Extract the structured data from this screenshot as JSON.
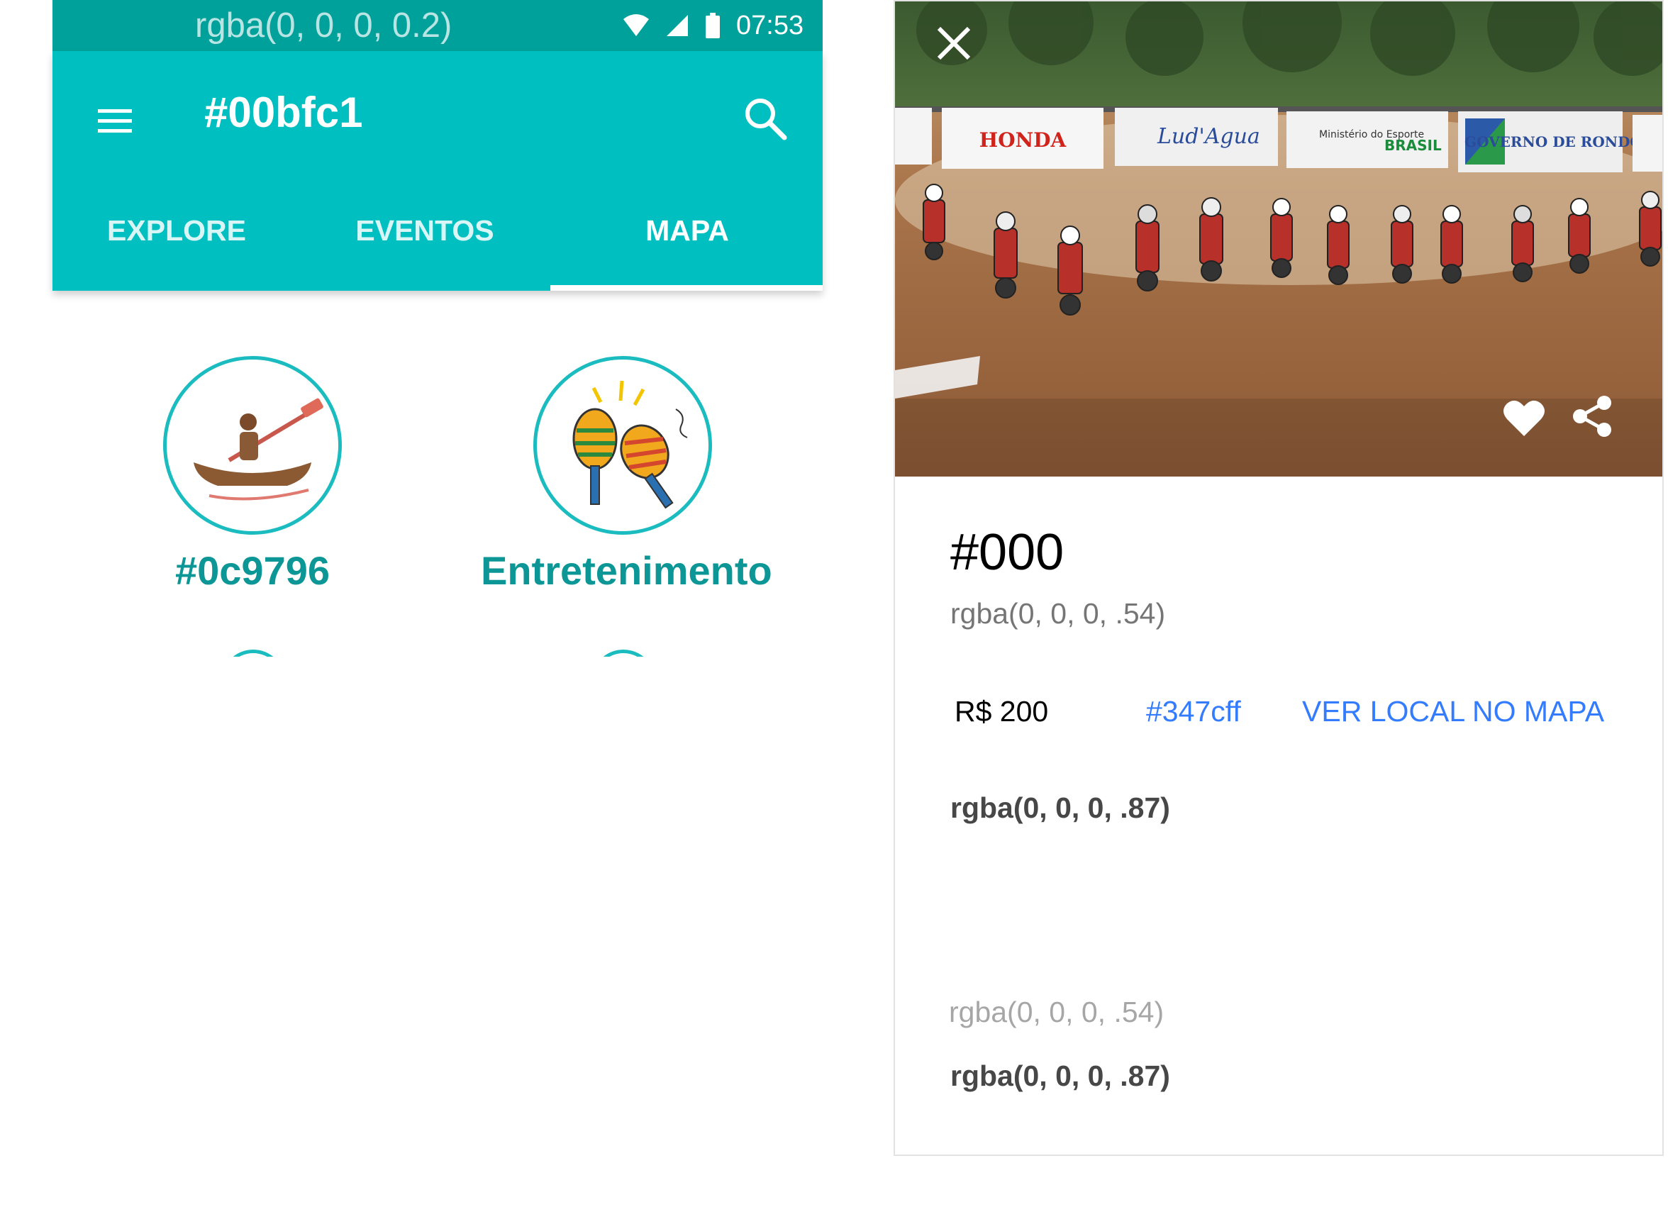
{
  "status_bar": {
    "text": "rgba(0, 0, 0, 0.2)",
    "time": "07:53",
    "icons": [
      "wifi-icon",
      "signal-icon",
      "battery-icon"
    ]
  },
  "app_bar": {
    "title": "#00bfc1",
    "menu_icon": "menu-icon",
    "search_icon": "search-icon",
    "color": "#00bfc1"
  },
  "tabs": [
    {
      "label": "EXPLORE",
      "active": false
    },
    {
      "label": "EVENTOS",
      "active": false
    },
    {
      "label": "MAPA",
      "active": true
    }
  ],
  "categories": [
    {
      "label": "#0c9796",
      "icon": "canoe-icon"
    },
    {
      "label": "Entretenimento",
      "icon": "maracas-icon"
    }
  ],
  "detail": {
    "hero_alt": "motocross-race-photo",
    "banners": [
      "HONDA",
      "Lud'Agua",
      "Ministério do Esporte",
      "BRASIL",
      "GOVERNO DE RONDÔNIA"
    ],
    "close_icon": "close-icon",
    "favorite_icon": "heart-icon",
    "share_icon": "share-icon",
    "title": "#000",
    "subtitle": "rgba(0, 0, 0, .54)",
    "price": "R$ 200",
    "link1": "#347cff",
    "link2": "VER LOCAL NO MAPA",
    "body1": "rgba(0, 0, 0, .87)",
    "meta_label": "rgba(0, 0, 0, .54)",
    "meta_value": "rgba(0, 0, 0, .87)",
    "accent_color": "#347cff"
  }
}
